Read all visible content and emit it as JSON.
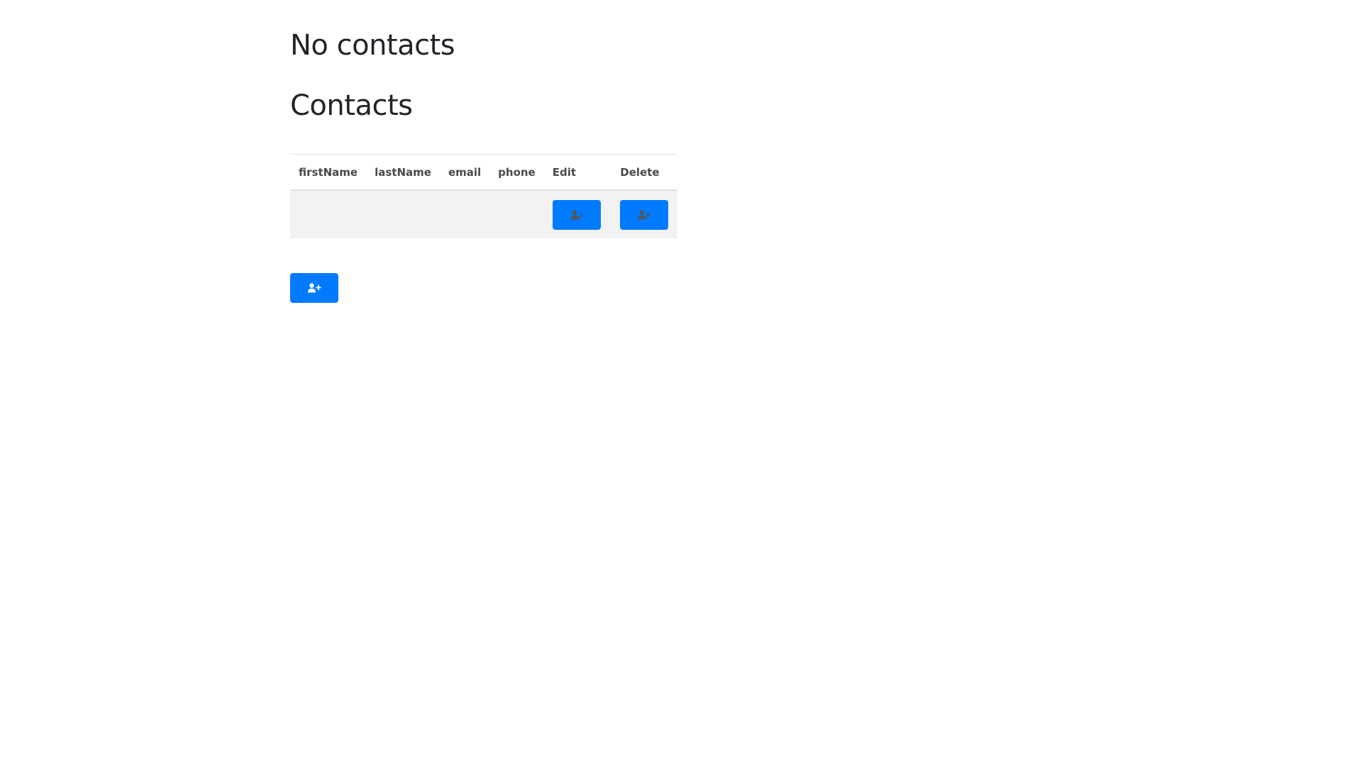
{
  "headings": {
    "empty_state": "No contacts",
    "title": "Contacts"
  },
  "table": {
    "columns": [
      "firstName",
      "lastName",
      "email",
      "phone",
      "Edit",
      "Delete"
    ],
    "rows": [
      {
        "firstName": "",
        "lastName": "",
        "email": "",
        "phone": ""
      }
    ]
  },
  "icons": {
    "edit": "user-edit-icon",
    "delete": "user-delete-icon",
    "add": "user-plus-icon"
  },
  "colors": {
    "accent": "#007bff",
    "row_background": "#f2f2f2",
    "header_text": "#4a4a4a",
    "icon_muted": "#555555",
    "icon_white": "#ffffff"
  }
}
